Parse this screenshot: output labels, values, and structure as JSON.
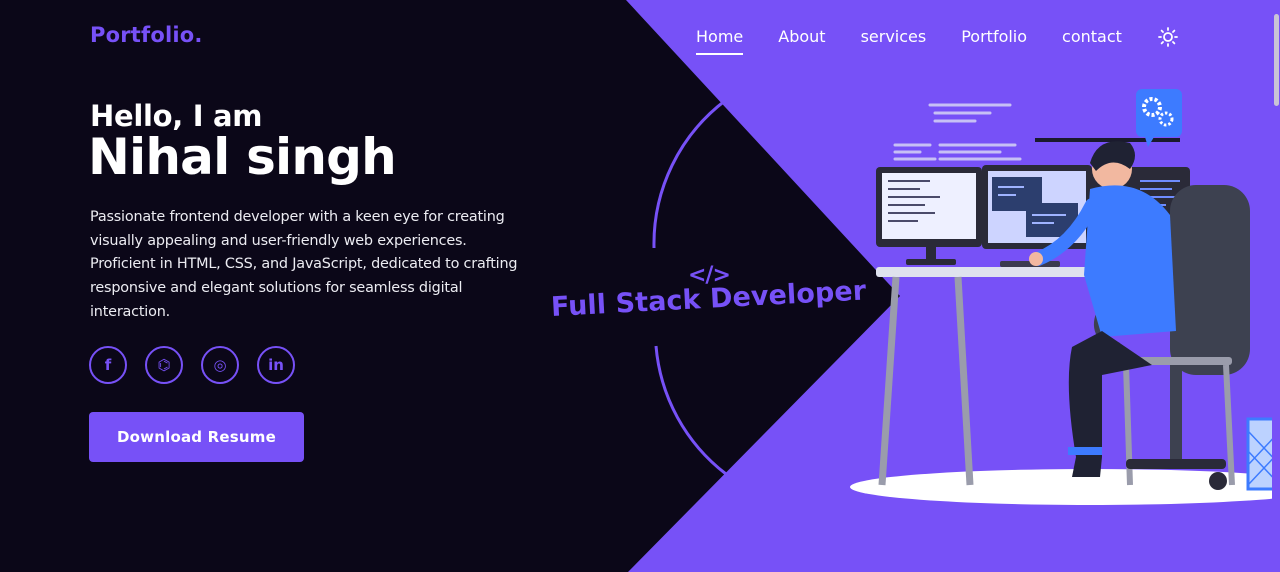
{
  "header": {
    "logo": "Portfolio.",
    "nav": [
      {
        "label": "Home",
        "active": true
      },
      {
        "label": "About",
        "active": false
      },
      {
        "label": "services",
        "active": false
      },
      {
        "label": "Portfolio",
        "active": false
      },
      {
        "label": "contact",
        "active": false
      }
    ],
    "theme_toggle_icon": "sun-icon"
  },
  "hero": {
    "greeting": "Hello, I am",
    "name": "Nihal singh",
    "description": "Passionate frontend developer with a keen eye for creating visually appealing and user-friendly web experiences. Proficient in HTML, CSS, and JavaScript, dedicated to crafting responsive and elegant solutions for seamless digital interaction.",
    "socials": [
      {
        "icon": "facebook-icon",
        "glyph": "f"
      },
      {
        "icon": "github-icon",
        "glyph": "⌬"
      },
      {
        "icon": "instagram-icon",
        "glyph": "◎"
      },
      {
        "icon": "linkedin-icon",
        "glyph": "in"
      }
    ],
    "button_label": "Download Resume"
  },
  "badge": {
    "code_symbol": "</>",
    "title": "Full Stack Developer"
  },
  "colors": {
    "accent": "#7751f7",
    "dark_bg": "#0b0718",
    "text": "#ffffff"
  }
}
